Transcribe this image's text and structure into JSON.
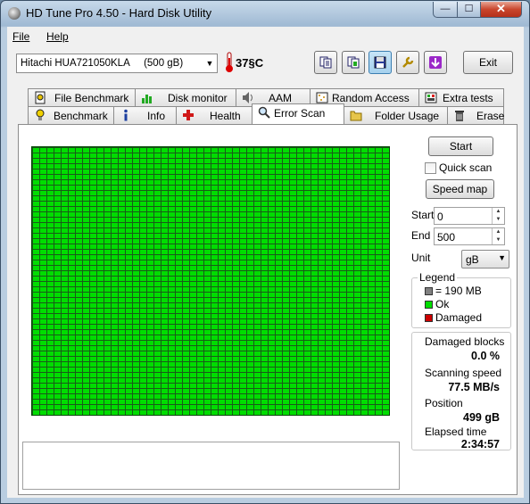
{
  "window": {
    "title": "HD Tune Pro 4.50 - Hard Disk Utility",
    "min": "—",
    "max": "☐",
    "close": "✕"
  },
  "menu": {
    "file": "File",
    "help": "Help"
  },
  "toolbar": {
    "drive": "Hitachi HUA721050KLA     (500 gB)",
    "temperature": "37§C",
    "exit_label": "Exit"
  },
  "tabs_top": [
    {
      "label": "File Benchmark"
    },
    {
      "label": "Disk monitor"
    },
    {
      "label": "AAM"
    },
    {
      "label": "Random Access"
    },
    {
      "label": "Extra tests"
    }
  ],
  "tabs_bottom": [
    {
      "label": "Benchmark"
    },
    {
      "label": "Info"
    },
    {
      "label": "Health"
    },
    {
      "label": "Error Scan"
    },
    {
      "label": "Folder Usage"
    },
    {
      "label": "Erase"
    }
  ],
  "scan": {
    "start_button": "Start",
    "quick_scan_label": "Quick scan",
    "quick_scan_checked": false,
    "speed_map_button": "Speed map",
    "start_label": "Start",
    "start_value": "0",
    "end_label": "End",
    "end_value": "500",
    "unit_label": "Unit",
    "unit_value": "gB"
  },
  "legend": {
    "title": "Legend",
    "block": "= 190 MB",
    "ok": "Ok",
    "damaged": "Damaged",
    "colors": {
      "block": "#808080",
      "ok": "#00dd00",
      "damaged": "#cc0000"
    }
  },
  "stats": {
    "damaged_label": "Damaged blocks",
    "damaged_value": "0.0 %",
    "speed_label": "Scanning speed",
    "speed_value": "77.5 MB/s",
    "position_label": "Position",
    "position_value": "499 gB",
    "elapsed_label": "Elapsed time",
    "elapsed_value": "2:34:57"
  }
}
